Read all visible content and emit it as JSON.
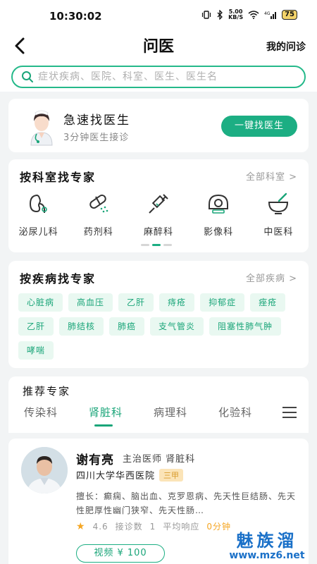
{
  "status": {
    "time": "10:30:02",
    "speed_value": "5.00",
    "speed_unit": "KB/S",
    "battery": "75"
  },
  "header": {
    "title": "问医",
    "right_link": "我的问诊"
  },
  "search": {
    "placeholder": "症状疾病、医院、科室、医生、医生名"
  },
  "quick": {
    "title": "急速找医生",
    "subtitle": "3分钟医生接诊",
    "button": "一键找医生"
  },
  "departments": {
    "title": "按科室找专家",
    "more": "全部科室 >",
    "items": [
      {
        "label": "泌尿儿科",
        "icon": "kidney-icon"
      },
      {
        "label": "药剂科",
        "icon": "pill-icon"
      },
      {
        "label": "麻醉科",
        "icon": "syringe-icon"
      },
      {
        "label": "影像科",
        "icon": "scanner-icon"
      },
      {
        "label": "中医科",
        "icon": "mortar-icon"
      }
    ]
  },
  "diseases": {
    "title": "按疾病找专家",
    "more": "全部疾病 >",
    "tags": [
      "心脏病",
      "高血压",
      "乙肝",
      "痔疮",
      "抑郁症",
      "痤疮",
      "乙肝",
      "肺结核",
      "肺癌",
      "支气管炎",
      "阻塞性肺气肿",
      "哮喘"
    ]
  },
  "recommend": {
    "title": "推荐专家",
    "tabs": [
      "传染科",
      "肾脏科",
      "病理科",
      "化验科"
    ],
    "active_tab": "肾脏科"
  },
  "doctor": {
    "name": "谢有亮",
    "title": "主治医师 肾脏科",
    "hospital": "四川大学华西医院",
    "grade": "三甲",
    "expertise": "擅长：癫痫、脑出血、克罗恩病、先天性巨结肠、先天性肥厚性幽门狭窄、先天性肠…",
    "rating": "4.6",
    "consult_label": "接诊数",
    "consult_count": "1",
    "response_label": "平均响应",
    "response_value": "0分钟",
    "price_label": "视频 ¥ 100"
  },
  "watermark": {
    "top": "魅族溜",
    "bottom": "www.mz6.net"
  },
  "colors": {
    "accent": "#1cae83",
    "tag_bg": "#e9f8f1",
    "star": "#f5a623",
    "watermark": "#1a70c8"
  }
}
